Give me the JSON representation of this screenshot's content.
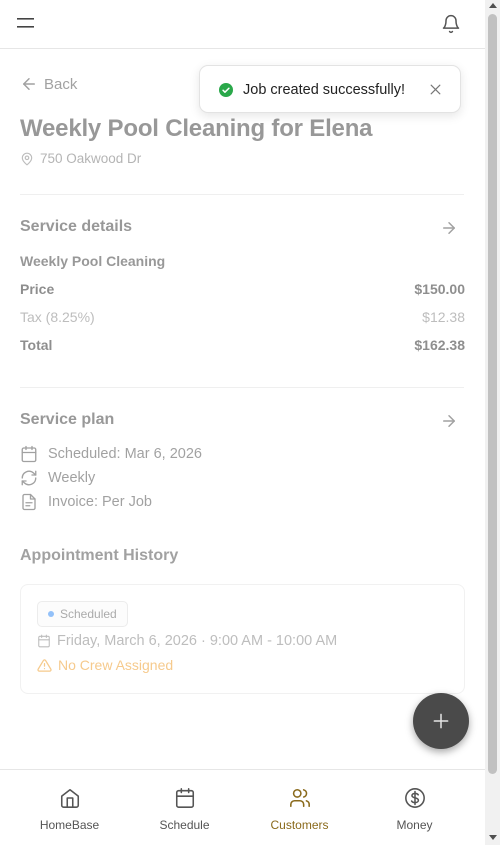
{
  "header": {
    "menu_icon": "hamburger-icon",
    "bell_icon": "bell-icon"
  },
  "page": {
    "back_label": "Back",
    "title": "Weekly Pool Cleaning for Elena",
    "address": "750 Oakwood Dr"
  },
  "service_details": {
    "heading": "Service details",
    "service_name": "Weekly Pool Cleaning",
    "price_label": "Price",
    "price_value": "$150.00",
    "tax_label": "Tax (8.25%)",
    "tax_value": "$12.38",
    "total_label": "Total",
    "total_value": "$162.38"
  },
  "service_plan": {
    "heading": "Service plan",
    "scheduled": "Scheduled: Mar 6, 2026",
    "frequency": "Weekly",
    "invoice": "Invoice: Per Job"
  },
  "appointment_history": {
    "heading": "Appointment History",
    "status": "Scheduled",
    "time": "Friday, March 6, 2026 · 9:00 AM - 10:00 AM",
    "warning": "No Crew Assigned"
  },
  "toast": {
    "message": "Job created successfully!"
  },
  "bottom_nav": {
    "items": [
      {
        "label": "HomeBase",
        "icon": "home-icon"
      },
      {
        "label": "Schedule",
        "icon": "calendar-icon"
      },
      {
        "label": "Customers",
        "icon": "users-icon"
      },
      {
        "label": "Money",
        "icon": "dollar-icon"
      }
    ],
    "active": "Customers"
  },
  "colors": {
    "accent_blue": "#1a8cf0",
    "active_nav": "#8a6a1c",
    "success": "#2aa84a",
    "warning": "#f0a030",
    "fab": "#4a4a4a"
  }
}
